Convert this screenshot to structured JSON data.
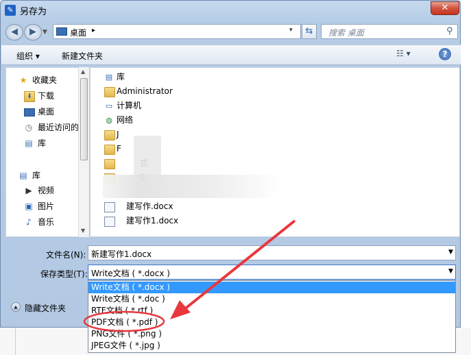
{
  "window": {
    "title": "另存为",
    "close_label": "✕"
  },
  "address_bar": {
    "location": "桌面",
    "separator": "▸",
    "dropdown": "▾",
    "refresh_icon": "refresh-icon",
    "search_placeholder": "搜索 桌面"
  },
  "toolbar": {
    "organize_label": "组织 ▾",
    "new_folder_label": "新建文件夹",
    "view_label": "☷ ▾",
    "help_label": "?"
  },
  "sidebar": {
    "items": [
      {
        "label": "收藏夹",
        "icon": "star-icon",
        "glyph": "★"
      },
      {
        "label": "下载",
        "icon": "downloads-folder-icon",
        "glyph": "⬇"
      },
      {
        "label": "桌面",
        "icon": "desktop-icon",
        "glyph": "▭"
      },
      {
        "label": "最近访问的",
        "icon": "recent-places-icon",
        "glyph": "◷"
      },
      {
        "label": "库",
        "icon": "libraries-icon",
        "glyph": "▤"
      },
      {
        "label": "库",
        "icon": "libraries-icon",
        "glyph": "▤"
      },
      {
        "label": "视频",
        "icon": "video-icon",
        "glyph": "▶"
      },
      {
        "label": "图片",
        "icon": "pictures-icon",
        "glyph": "▣"
      },
      {
        "label": "音乐",
        "icon": "music-icon",
        "glyph": "♪"
      }
    ]
  },
  "files": {
    "items": [
      {
        "label": "库",
        "icon": "libraries-icon"
      },
      {
        "label": "Administrator",
        "icon": "user-folder-icon"
      },
      {
        "label": "计算机",
        "icon": "computer-icon"
      },
      {
        "label": "网络",
        "icon": "network-icon"
      },
      {
        "label": "J",
        "icon": "folder-icon"
      },
      {
        "label": "F",
        "icon": "folder-icon"
      },
      {
        "label": "式",
        "icon": "folder-icon"
      },
      {
        "label": "5",
        "icon": "folder-icon"
      },
      {
        "label": "建写作.docx",
        "icon": "document-icon"
      },
      {
        "label": "建写作1.docx",
        "icon": "document-icon"
      }
    ]
  },
  "form": {
    "filename_label": "文件名(N):",
    "filename_value": "新建写作1.docx",
    "filetype_label": "保存类型(T):",
    "filetype_value": "Write文档 ( *.docx )",
    "hide_folders_label": "隐藏文件夹"
  },
  "filetype_options": [
    "Write文档 ( *.docx )",
    "Write文档 ( *.doc )",
    "RTF文档 ( *.rtf )",
    "PDF文档 ( *.pdf )",
    "PNG文件 ( *.png )",
    "JPEG文件 ( *.jpg )"
  ],
  "colors": {
    "selection": "#3399ff",
    "annotation": "#e8373d",
    "title_bar": "#c6d9ee"
  }
}
